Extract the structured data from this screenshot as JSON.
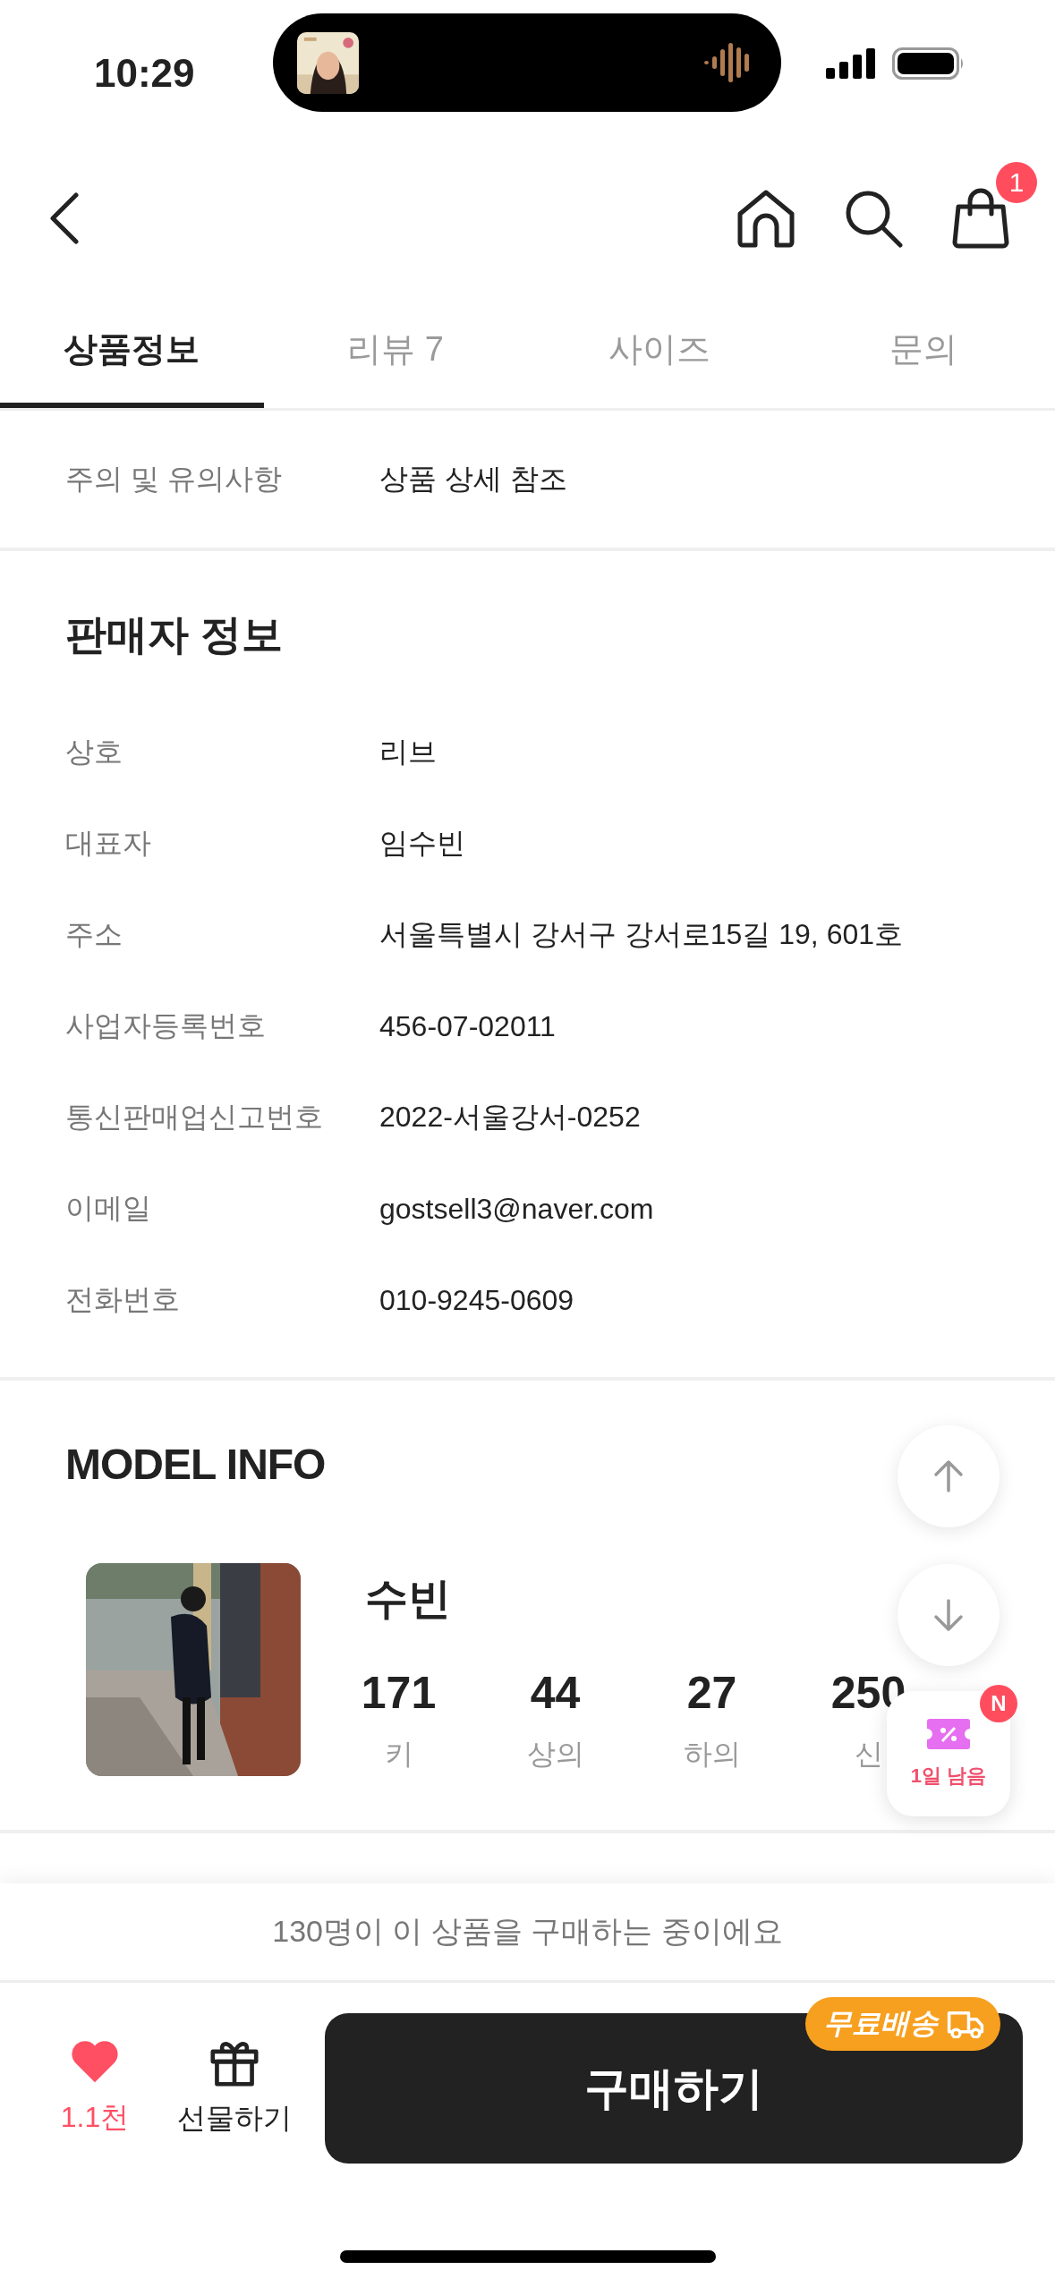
{
  "status_bar": {
    "time": "10:29"
  },
  "nav": {
    "cart_count": "1"
  },
  "tabs": [
    {
      "label": "상품정보",
      "selected": true
    },
    {
      "label": "리뷰 7",
      "selected": false
    },
    {
      "label": "사이즈",
      "selected": false
    },
    {
      "label": "문의",
      "selected": false
    }
  ],
  "notice_row": {
    "label": "주의 및 유의사항",
    "value": "상품 상세 참조"
  },
  "seller_info": {
    "title": "판매자 정보",
    "rows": [
      {
        "label": "상호",
        "value": "리브"
      },
      {
        "label": "대표자",
        "value": "임수빈"
      },
      {
        "label": "주소",
        "value": "서울특별시 강서구 강서로15길 19, 601호"
      },
      {
        "label": "사업자등록번호",
        "value": "456-07-02011"
      },
      {
        "label": "통신판매업신고번호",
        "value": "2022-서울강서-0252"
      },
      {
        "label": "이메일",
        "value": "gostsell3@naver.com"
      },
      {
        "label": "전화번호",
        "value": "010-9245-0609"
      }
    ]
  },
  "model_info": {
    "title": "MODEL INFO",
    "name": "수빈",
    "stats": [
      {
        "value": "171",
        "label": "키"
      },
      {
        "value": "44",
        "label": "상의"
      },
      {
        "value": "27",
        "label": "하의"
      },
      {
        "value": "250",
        "label": "신"
      }
    ]
  },
  "coupon": {
    "badge": "N",
    "label": "1일 남음"
  },
  "bottom_bar": {
    "buyers_note": "130명이 이 상품을 구매하는 중이에요",
    "like": {
      "liked": true,
      "count": "1.1천"
    },
    "gift_label": "선물하기",
    "buy_button": "구매하기",
    "shipping_badge": "무료배송"
  }
}
